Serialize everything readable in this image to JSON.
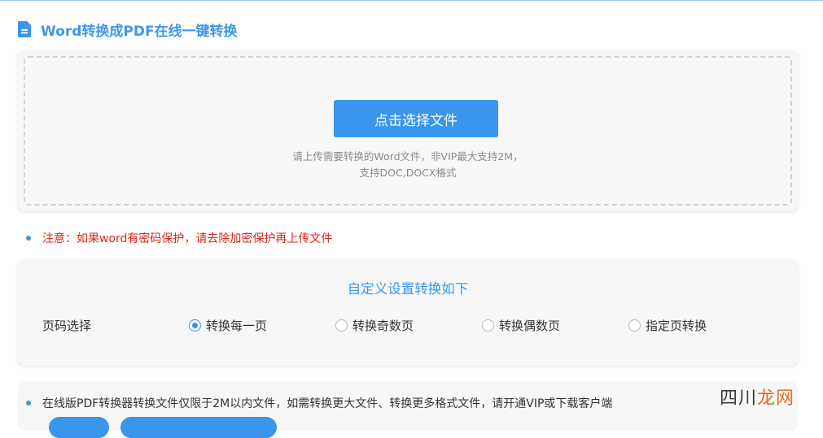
{
  "header": {
    "title": "Word转换成PDF在线一键转换",
    "icon": "document-icon"
  },
  "upload": {
    "button_label": "点击选择文件",
    "hint_line1": "请上传需要转换的Word文件，非VIP最大支持2M，",
    "hint_line2": "支持DOC,DOCX格式"
  },
  "notice": {
    "text": "注意：如果word有密码保护，请去除加密保护再上传文件"
  },
  "settings": {
    "title": "自定义设置转换如下",
    "page_label": "页码选择",
    "options": [
      {
        "label": "转换每一页",
        "checked": true
      },
      {
        "label": "转换奇数页",
        "checked": false
      },
      {
        "label": "转换偶数页",
        "checked": false
      },
      {
        "label": "指定页转换",
        "checked": false
      }
    ]
  },
  "info": {
    "text": "在线版PDF转换器转换文件仅限于2M以内文件，如需转换更大文件、转换更多格式文件，请开通VIP或下载客户端"
  },
  "watermark": {
    "part1": "四川",
    "part2": "龙网"
  },
  "colors": {
    "accent": "#3a96ec",
    "title": "#3f97e8",
    "warning": "#e0241a"
  }
}
